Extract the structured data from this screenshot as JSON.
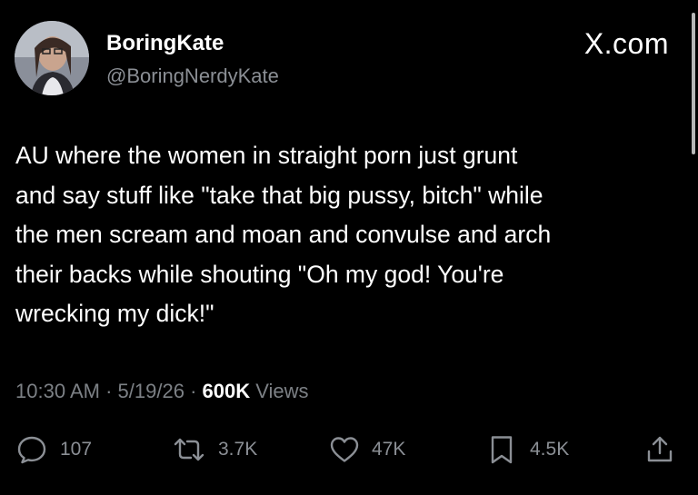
{
  "author": {
    "display_name": "BoringKate",
    "handle": "@BoringNerdyKate"
  },
  "brand": "X.com",
  "tweet": {
    "lines": [
      "AU where the women in straight porn just grunt",
      "and say stuff like \"take that big pussy, bitch\" while",
      "the men scream and moan and convulse and arch",
      "their backs while shouting \"Oh my god! You're",
      "wrecking my dick!\""
    ]
  },
  "meta": {
    "time": "10:30 AM",
    "separator": "·",
    "date": "5/19/26",
    "views_count": "600K",
    "views_label": "Views"
  },
  "actions": {
    "replies": "107",
    "reposts": "3.7K",
    "likes": "47K",
    "bookmarks": "4.5K"
  },
  "icons": [
    "reply-icon",
    "repost-icon",
    "like-icon",
    "bookmark-icon",
    "share-icon"
  ]
}
